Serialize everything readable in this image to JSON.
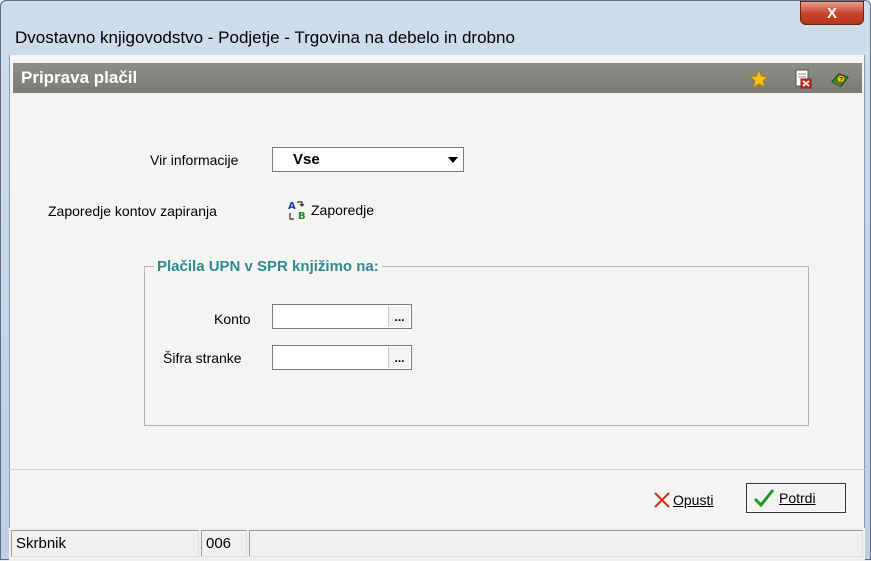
{
  "window": {
    "title": "Dvostavno knjigovodstvo - Podjetje - Trgovina na debelo in drobno",
    "close_label": "X"
  },
  "header": {
    "title": "Priprava plačil",
    "icons": [
      "star-icon",
      "close-document-icon",
      "help-book-icon"
    ]
  },
  "form": {
    "source_label": "Vir informacije",
    "source_value": "Vse",
    "order_label": "Zaporedje kontov zapiranja",
    "order_link": "Zaporedje",
    "group_title": "Plačila UPN v SPR knjižimo na:",
    "konto_label": "Konto",
    "konto_value": "",
    "partner_label": "Šifra stranke",
    "partner_value": "",
    "browse_label": "..."
  },
  "buttons": {
    "cancel_label": "Opusti",
    "confirm_label": "Potrdi"
  },
  "status": {
    "user": "Skrbnik",
    "code": "006"
  }
}
